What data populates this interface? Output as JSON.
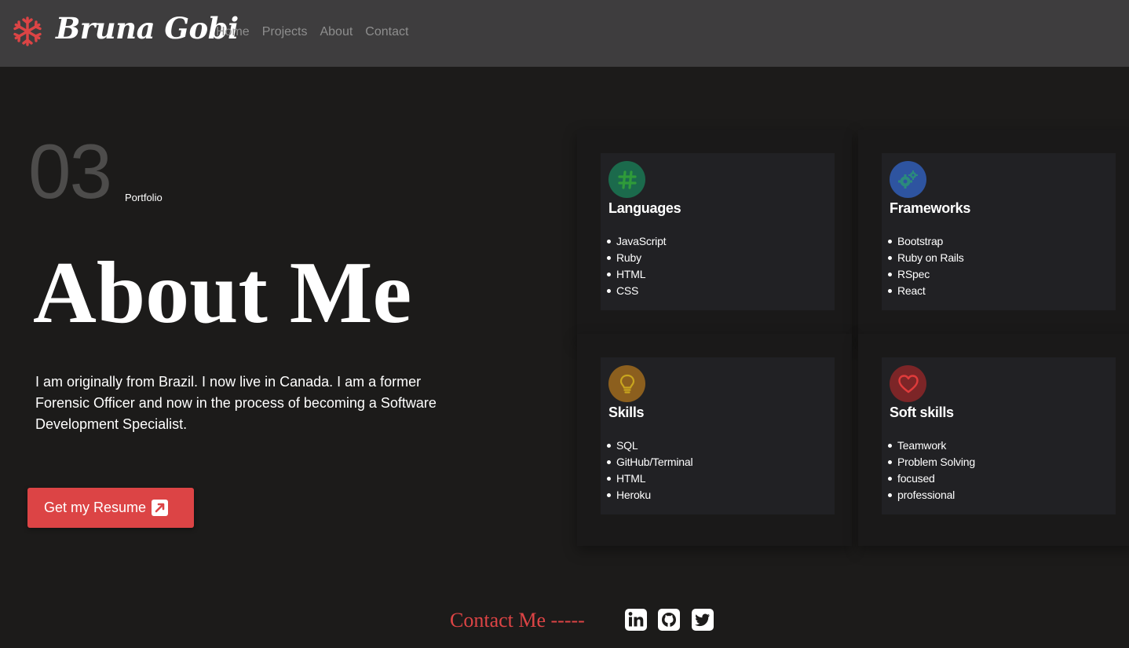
{
  "nav": {
    "logo_icon": "snowflake-icon",
    "brand": "Bruna Gobi",
    "links": [
      "Home",
      "Projects",
      "About",
      "Contact"
    ]
  },
  "colors": {
    "accent": "#dc4445",
    "navbar_bg": "#3e3d3e",
    "page_bg": "#1c1b1a",
    "card_bg": "#212124"
  },
  "hero": {
    "section_number": "03",
    "section_label": "Portfolio",
    "title": "About Me",
    "description": "I am originally from Brazil. I now live in Canada. I am a former Forensic Officer and now in the process of becoming a Software Development Specialist.",
    "resume_button": "Get my Resume",
    "resume_icon": "external-link-icon"
  },
  "cards": [
    {
      "icon": "hashtag-icon",
      "icon_color": "#1b6a4c",
      "title": "Languages",
      "items": [
        "JavaScript",
        "Ruby",
        "HTML",
        "CSS"
      ]
    },
    {
      "icon": "gears-icon",
      "icon_color": "#2e54a0",
      "title": "Frameworks",
      "items": [
        "Bootstrap",
        "Ruby on Rails",
        "RSpec",
        "React"
      ]
    },
    {
      "icon": "lightbulb-icon",
      "icon_color": "#8c5f1e",
      "title": "Skills",
      "items": [
        "SQL",
        "GitHub/Terminal",
        "HTML",
        "Heroku"
      ]
    },
    {
      "icon": "heart-icon",
      "icon_color": "#7c2527",
      "title": "Soft skills",
      "items": [
        "Teamwork",
        "Problem Solving",
        "focused",
        "professional"
      ]
    }
  ],
  "footer": {
    "contact_label": "Contact Me -----",
    "social_icons": [
      "linkedin-icon",
      "github-icon",
      "twitter-icon"
    ]
  }
}
